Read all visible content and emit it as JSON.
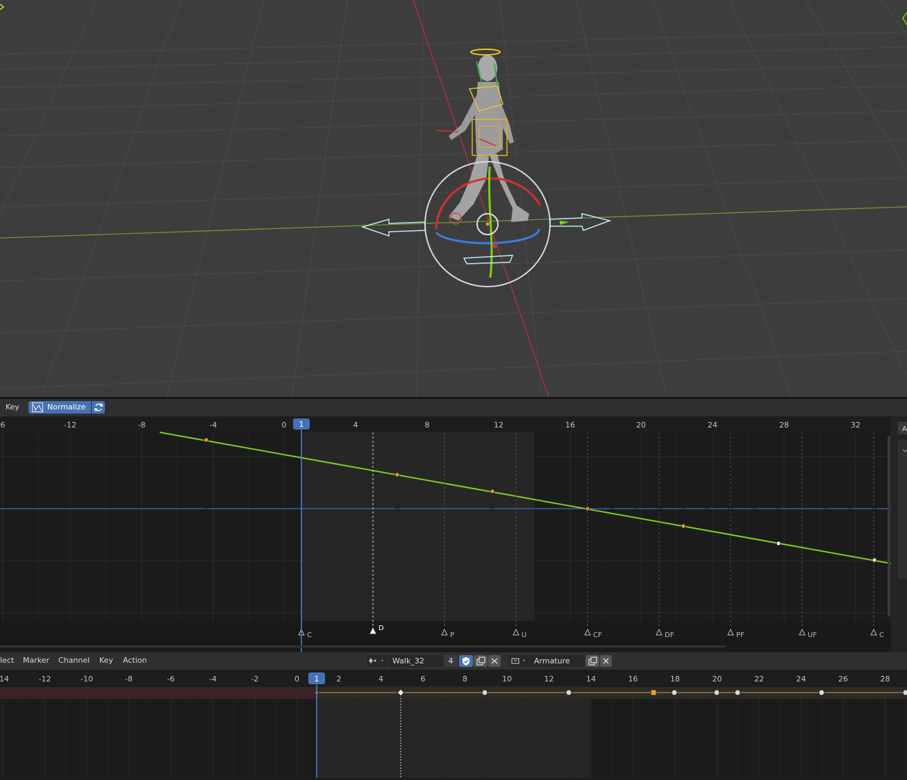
{
  "graph_header": {
    "key_menu": "Key",
    "normalize_label": "Normalize",
    "side_tab": "A"
  },
  "graph_ruler": {
    "labels": [
      "6",
      "-12",
      "-8",
      "-4",
      "0",
      "4",
      "8",
      "12",
      "16",
      "20",
      "24",
      "28",
      "32"
    ],
    "current_frame": "1"
  },
  "graph_markers": [
    "C",
    "D",
    "P",
    "U",
    "CF",
    "DF",
    "PF",
    "UF",
    "C"
  ],
  "timeline_header": {
    "menus": [
      "lect",
      "Marker",
      "Channel",
      "Key",
      "Action"
    ],
    "action_name": "Walk_32",
    "action_users": "4",
    "object_name": "Armature"
  },
  "timeline_ruler": {
    "labels": [
      "14",
      "-12",
      "-10",
      "-8",
      "-6",
      "-4",
      "-2",
      "0",
      "2",
      "4",
      "6",
      "8",
      "10",
      "12",
      "14",
      "16",
      "18",
      "20",
      "22",
      "24",
      "26",
      "28"
    ],
    "current_frame": "1"
  },
  "colors": {
    "accent": "#4772b3",
    "curve": "#7fcf1a",
    "keyframe_selected": "#e0a030",
    "x_axis": "#b3333c",
    "y_axis": "#6e9a32"
  }
}
